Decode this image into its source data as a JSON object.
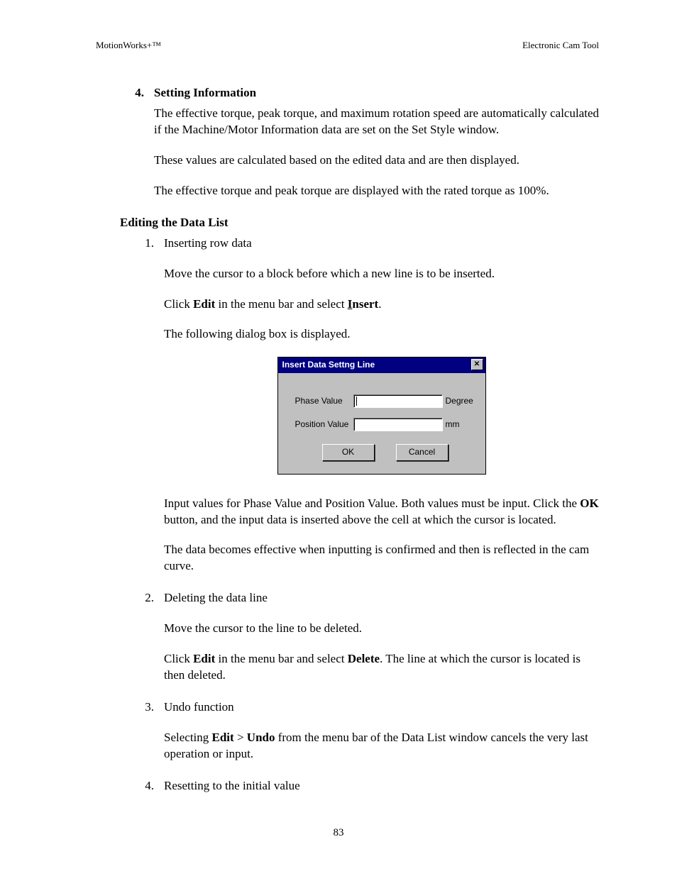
{
  "header": {
    "left": "MotionWorks+™",
    "right": "Electronic Cam Tool"
  },
  "section4": {
    "num": "4.",
    "title": "Setting Information",
    "p1": "The effective torque, peak torque, and maximum rotation speed are automatically calculated if the Machine/Motor Information data are set on the Set Style window.",
    "p2": "These values are calculated based on the edited data and are then displayed.",
    "p3": "The effective torque and peak torque are displayed with the rated torque as 100%."
  },
  "editHeading": "Editing the Data List",
  "item1": {
    "num": "1.",
    "title": "Inserting row data",
    "p1": "Move the cursor to a block before which a new line is to be inserted.",
    "p2a": "Click ",
    "p2b": "Edit",
    "p2c": " in the menu bar and select ",
    "p2d_underline": "I",
    "p2d_rest": "nsert",
    "p2e": ".",
    "p3": "The following dialog box is displayed.",
    "p4a": "Input values for Phase Value and Position Value.  Both values must be input. Click the ",
    "p4b": "OK",
    "p4c": " button, and the input data is inserted above the cell at which the cursor is located.",
    "p5": "The data becomes effective when inputting is confirmed and then is reflected in the cam curve."
  },
  "dialog": {
    "title": "Insert Data Settng Line",
    "row1_label": "Phase Value",
    "row1_unit": "Degree",
    "row2_label": "Position Value",
    "row2_unit": "mm",
    "ok": "OK",
    "cancel": "Cancel"
  },
  "item2": {
    "num": "2.",
    "title": "Deleting the data line",
    "p1": "Move the cursor to the line to be deleted.",
    "p2a": "Click ",
    "p2b": "Edit",
    "p2c": " in the menu bar and select ",
    "p2d": "Delete",
    "p2e": ". The line at which the cursor is located is then deleted."
  },
  "item3": {
    "num": "3.",
    "title": "Undo function",
    "p1a": "Selecting ",
    "p1b": "Edit",
    "p1c": " > ",
    "p1d": "Undo",
    "p1e": " from the menu bar of the Data List window cancels the very last operation or input."
  },
  "item4": {
    "num": "4.",
    "title": "Resetting to the initial value"
  },
  "pageNumber": "83"
}
